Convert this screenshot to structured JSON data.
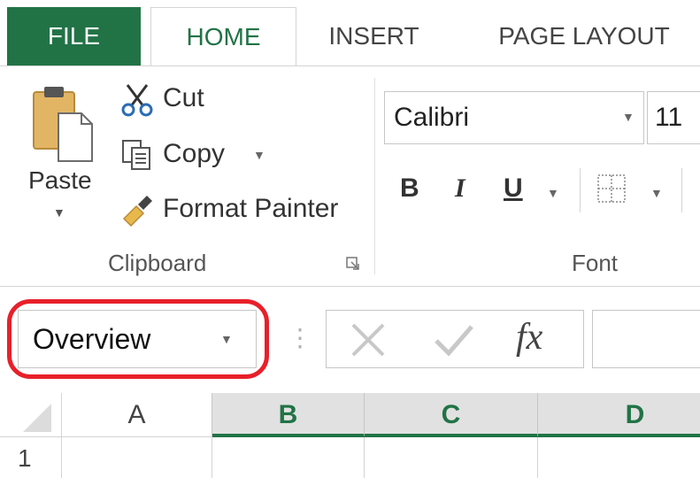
{
  "ribbon_tabs": {
    "file": "FILE",
    "home": "HOME",
    "insert": "INSERT",
    "page_layout": "PAGE LAYOUT"
  },
  "clipboard": {
    "paste": "Paste",
    "cut": "Cut",
    "copy": "Copy",
    "format_painter": "Format Painter",
    "group_label": "Clipboard"
  },
  "font": {
    "name": "Calibri",
    "size": "11",
    "bold": "B",
    "italic": "I",
    "underline": "U",
    "group_label": "Font"
  },
  "formula_bar": {
    "name_box_value": "Overview",
    "fx_label": "fx"
  },
  "grid": {
    "columns": [
      "A",
      "B",
      "C",
      "D"
    ],
    "rows": [
      "1"
    ]
  },
  "colors": {
    "excel_green": "#217346",
    "highlight_red": "#e8202a"
  }
}
